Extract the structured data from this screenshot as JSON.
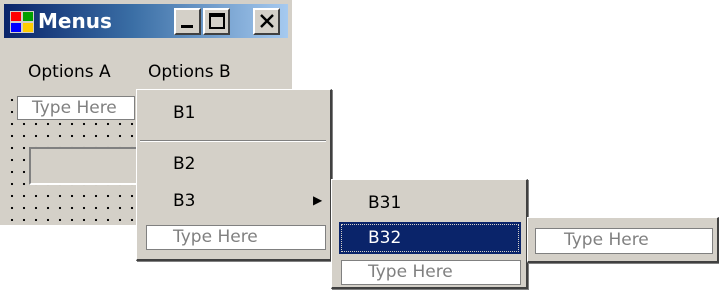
{
  "window": {
    "title": "Menus",
    "minimize_glyph": "_",
    "maximize_glyph": "☐",
    "close_glyph": "✕"
  },
  "menubar": {
    "items": [
      {
        "label": "Options A"
      },
      {
        "label": "Options B"
      }
    ]
  },
  "form": {
    "menu_type_here": "Type Here"
  },
  "menu_b": {
    "items": [
      {
        "label": "B1"
      },
      {
        "label": "B2"
      },
      {
        "label": "B3",
        "arrow": "▶"
      }
    ],
    "type_here": "Type Here"
  },
  "menu_b3": {
    "items": [
      {
        "label": "B31"
      },
      {
        "label": "B32",
        "selected": true
      }
    ],
    "type_here": "Type Here"
  },
  "menu_b32": {
    "type_here": "Type Here"
  },
  "colors": {
    "selection": "#0a246a",
    "face": "#d4d0c8",
    "title_start": "#0a246a",
    "title_end": "#a6caf0"
  }
}
